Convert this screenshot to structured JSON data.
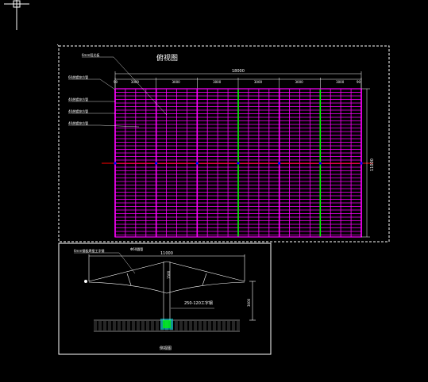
{
  "colors": {
    "background": "#000000",
    "frame": "#ffffff",
    "grid": "#ff00ff",
    "green_line": "#00ff00",
    "red_axis": "#ff0000",
    "blue_node": "#0000ff",
    "cyan": "#00ffff",
    "annotation": "#ffffff"
  },
  "top_view": {
    "title": "俯视图",
    "total_width": "18000",
    "height_dim": "11000",
    "edge_left": "90",
    "edge_right": "90",
    "spans": [
      "3000",
      "3000",
      "3000",
      "3000",
      "3000",
      "3000"
    ],
    "labels": [
      "6mm阳光板",
      "60热镀锌方管",
      "40热镀锌方管",
      "40热镀锌方管",
      "40热镀锌方管"
    ]
  },
  "side_view": {
    "title": "侧视图",
    "top_width": "11000",
    "pipe_label": "Φ60圆管",
    "beam_label": "6mm钢板焊接工字钢",
    "post_label": "250-120工字钢",
    "post_height": "1500",
    "total_height": "3000"
  }
}
